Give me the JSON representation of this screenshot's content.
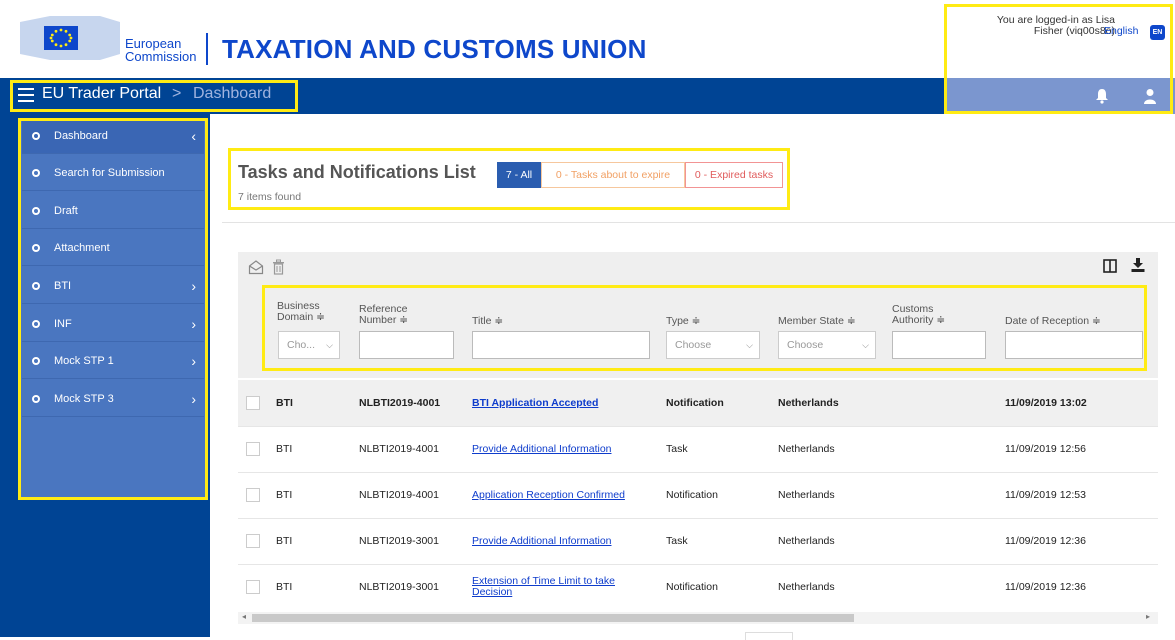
{
  "header": {
    "commission_line1": "European",
    "commission_line2": "Commission",
    "site_title": "TAXATION AND CUSTOMS UNION",
    "user_text_line1": "You are logged-in as Lisa",
    "user_text_line2": "Fisher (viq00s8o)",
    "language": "English",
    "language_badge": "EN"
  },
  "nav": {
    "portal": "EU Trader Portal",
    "separator": ">",
    "current": "Dashboard"
  },
  "sidebar": {
    "items": [
      {
        "label": "Dashboard",
        "chevron": "‹"
      },
      {
        "label": "Search for Submission",
        "chevron": ""
      },
      {
        "label": "Draft",
        "chevron": ""
      },
      {
        "label": "Attachment",
        "chevron": ""
      },
      {
        "label": "BTI",
        "chevron": "›"
      },
      {
        "label": "INF",
        "chevron": "›"
      },
      {
        "label": "Mock STP 1",
        "chevron": "›"
      },
      {
        "label": "Mock STP 3",
        "chevron": "›"
      }
    ]
  },
  "tasks": {
    "title": "Tasks and Notifications List",
    "items_found": "7 items found",
    "tab_all": "7 - All",
    "tab_expire": "0 - Tasks about to expire",
    "tab_expired": "0 - Expired tasks"
  },
  "table": {
    "headers": {
      "business_domain_1": "Business",
      "business_domain_2": "Domain ≑",
      "reference_1": "Reference",
      "reference_2": "Number ≑",
      "title": "Title ≑",
      "type": "Type ≑",
      "member_state": "Member State ≑",
      "customs_1": "Customs",
      "customs_2": "Authority ≑",
      "date": "Date of Reception ≑"
    },
    "filters": {
      "domain_select": "Cho...",
      "type_select": "Choose",
      "member_select": "Choose"
    },
    "rows": [
      {
        "domain": "BTI",
        "ref": "NLBTI2019-4001",
        "title": "BTI Application Accepted",
        "type": "Notification",
        "state": "Netherlands",
        "date": "11/09/2019 13:02"
      },
      {
        "domain": "BTI",
        "ref": "NLBTI2019-4001",
        "title": "Provide Additional Information",
        "type": "Task",
        "state": "Netherlands",
        "date": "11/09/2019 12:56"
      },
      {
        "domain": "BTI",
        "ref": "NLBTI2019-4001",
        "title": "Application Reception Confirmed",
        "type": "Notification",
        "state": "Netherlands",
        "date": "11/09/2019 12:53"
      },
      {
        "domain": "BTI",
        "ref": "NLBTI2019-3001",
        "title": "Provide Additional Information",
        "type": "Task",
        "state": "Netherlands",
        "date": "11/09/2019 12:36"
      },
      {
        "domain": "BTI",
        "ref": "NLBTI2019-3001",
        "title_line1": "Extension of Time Limit to take",
        "title_line2": "Decision",
        "type": "Notification",
        "state": "Netherlands",
        "date": "11/09/2019 12:36"
      }
    ]
  },
  "scroll": {
    "left": "◂",
    "right": "▸"
  },
  "colors": {
    "brand_blue": "#004494",
    "highlight": "#ffeb14",
    "link": "#0e3ccc"
  }
}
